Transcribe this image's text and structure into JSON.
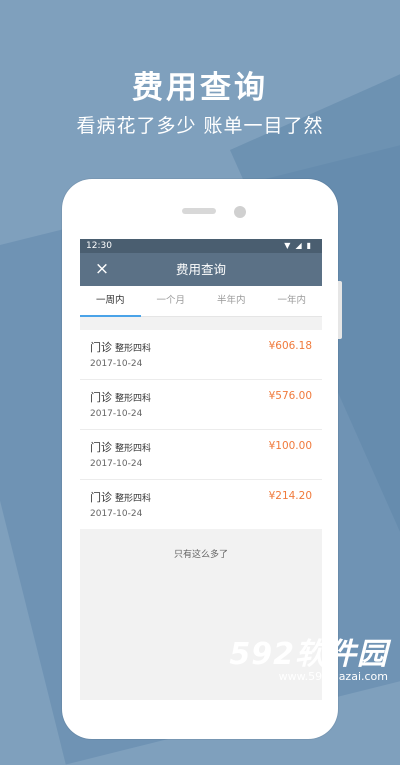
{
  "hero": {
    "title": "费用查询",
    "subtitle": "看病花了多少  账单一目了然"
  },
  "statusbar": {
    "time": "12:30",
    "icons": [
      "wifi-icon",
      "signal-icon",
      "battery-icon"
    ]
  },
  "appbar": {
    "close_icon": "×",
    "title": "费用查询"
  },
  "tabs": [
    {
      "label": "一周内",
      "active": true
    },
    {
      "label": "一个月",
      "active": false
    },
    {
      "label": "半年内",
      "active": false
    },
    {
      "label": "一年内",
      "active": false
    }
  ],
  "records": [
    {
      "type": "门诊",
      "dept": "整形四科",
      "date": "2017-10-24",
      "amount": "¥606.18"
    },
    {
      "type": "门诊",
      "dept": "整形四科",
      "date": "2017-10-24",
      "amount": "¥576.00"
    },
    {
      "type": "门诊",
      "dept": "整形四科",
      "date": "2017-10-24",
      "amount": "¥100.00"
    },
    {
      "type": "门诊",
      "dept": "整形四科",
      "date": "2017-10-24",
      "amount": "¥214.20"
    }
  ],
  "list_footer": "只有这么多了",
  "watermark": {
    "brand": "592软件园",
    "url": "www.592xiazai.com"
  },
  "colors": {
    "appbar": "#5b7186",
    "statusbar": "#4a5e70",
    "tab_indicator": "#4aa3e8",
    "amount": "#f07a3c",
    "background": "#7fa0bd"
  }
}
